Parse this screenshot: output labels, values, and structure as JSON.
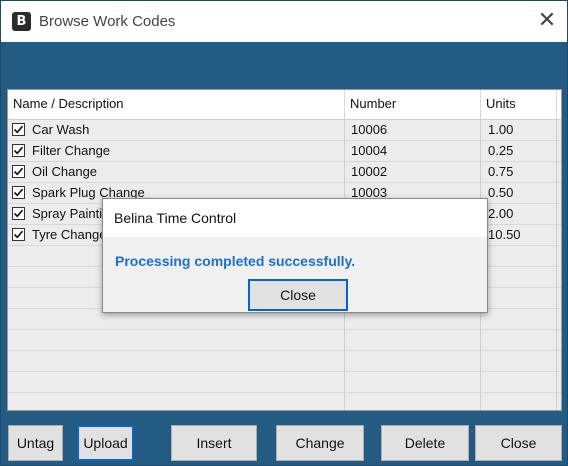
{
  "window": {
    "title": "Browse Work Codes",
    "icon": "app-logo-icon",
    "close_glyph": "✕"
  },
  "grid": {
    "columns": [
      "Name / Description",
      "Number",
      "Units"
    ],
    "rows": [
      {
        "name": "Car Wash",
        "number": "10006",
        "units": "1.00",
        "checked": true
      },
      {
        "name": "Filter Change",
        "number": "10004",
        "units": "0.25",
        "checked": true
      },
      {
        "name": "Oil Change",
        "number": "10002",
        "units": "0.75",
        "checked": true
      },
      {
        "name": "Spark Plug Change",
        "number": "10003",
        "units": "0.50",
        "checked": true
      },
      {
        "name": "Spray Painting",
        "number": "",
        "units": "2.00",
        "checked": true
      },
      {
        "name": "Tyre Change",
        "number": "",
        "units": "10.50",
        "checked": true
      }
    ]
  },
  "buttons": {
    "untag": "Untag",
    "upload": "Upload",
    "insert": "Insert",
    "change": "Change",
    "delete": "Delete",
    "close": "Close"
  },
  "dialog": {
    "title": "Belina Time Control",
    "message": "Processing completed successfully.",
    "close_label": "Close"
  },
  "colors": {
    "frame": "#235b82",
    "message": "#1c6fd6",
    "focus": "#0a64c8"
  }
}
